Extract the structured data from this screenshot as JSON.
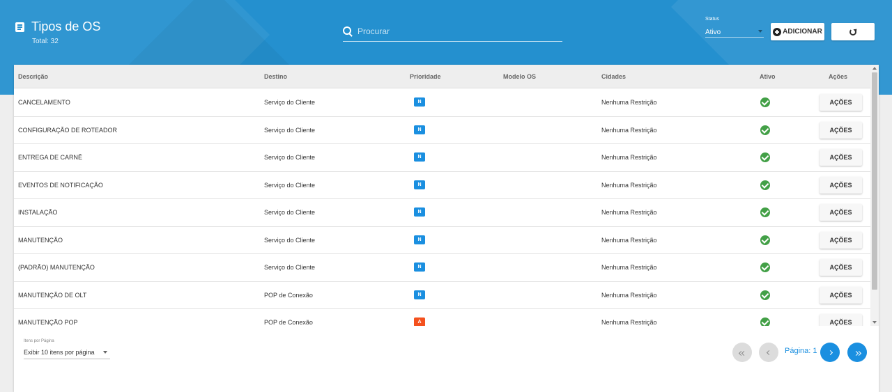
{
  "header": {
    "title": "Tipos de OS",
    "total": "Total: 32",
    "search_placeholder": "Procurar",
    "status_label": "Status",
    "status_value": "Ativo",
    "add_label": "ADICIONAR"
  },
  "table": {
    "columns": [
      "Descrição",
      "Destino",
      "Prioridade",
      "Modelo OS",
      "Cidades",
      "Ativo",
      "Ações"
    ],
    "rows": [
      {
        "descricao": "CANCELAMENTO",
        "destino": "Serviço do Cliente",
        "prioridade": "N",
        "modelo": "",
        "cidades": "Nenhuma Restrição",
        "acoes": "AÇÕES"
      },
      {
        "descricao": "CONFIGURAÇÃO DE ROTEADOR",
        "destino": "Serviço do Cliente",
        "prioridade": "N",
        "modelo": "",
        "cidades": "Nenhuma Restrição",
        "acoes": "AÇÕES"
      },
      {
        "descricao": "ENTREGA DE CARNÊ",
        "destino": "Serviço do Cliente",
        "prioridade": "N",
        "modelo": "",
        "cidades": "Nenhuma Restrição",
        "acoes": "AÇÕES"
      },
      {
        "descricao": "EVENTOS DE NOTIFICAÇÃO",
        "destino": "Serviço do Cliente",
        "prioridade": "N",
        "modelo": "",
        "cidades": "Nenhuma Restrição",
        "acoes": "AÇÕES"
      },
      {
        "descricao": "INSTALAÇÃO",
        "destino": "Serviço do Cliente",
        "prioridade": "N",
        "modelo": "",
        "cidades": "Nenhuma Restrição",
        "acoes": "AÇÕES"
      },
      {
        "descricao": "MANUTENÇÃO",
        "destino": "Serviço do Cliente",
        "prioridade": "N",
        "modelo": "",
        "cidades": "Nenhuma Restrição",
        "acoes": "AÇÕES"
      },
      {
        "descricao": "(PADRÃO) MANUTENÇÃO",
        "destino": "Serviço do Cliente",
        "prioridade": "N",
        "modelo": "",
        "cidades": "Nenhuma Restrição",
        "acoes": "AÇÕES"
      },
      {
        "descricao": "MANUTENÇÃO DE OLT",
        "destino": "POP de Conexão",
        "prioridade": "N",
        "modelo": "",
        "cidades": "Nenhuma Restrição",
        "acoes": "AÇÕES"
      },
      {
        "descricao": "MANUTENÇÃO POP",
        "destino": "POP de Conexão",
        "prioridade": "A",
        "modelo": "",
        "cidades": "Nenhuma Restrição",
        "acoes": "AÇÕES"
      }
    ]
  },
  "priority_colors": {
    "N": "#1a8fe0",
    "A": "#f4511e"
  },
  "pagination": {
    "per_page_label": "Itens por Página",
    "per_page_value": "Exibir 10 itens por página",
    "page_text": "Página: 1"
  },
  "colors": {
    "header_bg": "#2490cf",
    "accent": "#1a8fe0",
    "active_green": "#43a047"
  }
}
